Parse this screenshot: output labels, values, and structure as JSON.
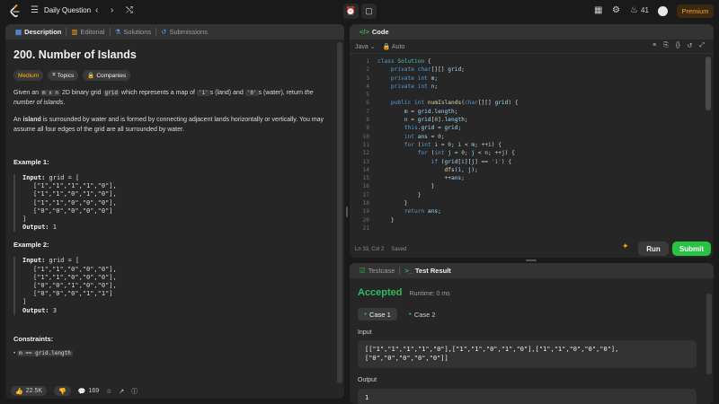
{
  "topbar": {
    "problem_list_label": "Daily Question",
    "streak_count": "41",
    "premium_label": "Premium"
  },
  "description_panel": {
    "tabs": [
      {
        "label": "Description"
      },
      {
        "label": "Editorial"
      },
      {
        "label": "Solutions"
      },
      {
        "label": "Submissions"
      }
    ],
    "title": "200. Number of Islands",
    "chips": [
      {
        "label": "Medium"
      },
      {
        "label": "Topics"
      },
      {
        "label": "Companies"
      }
    ],
    "para1": {
      "a": "Given an ",
      "code1": "m x n",
      "b": " 2D binary grid ",
      "code2": "grid",
      "c": " which represents a map of ",
      "code3": "'1'",
      "d": "s (land) and ",
      "code4": "'0'",
      "e": "s (water), return ",
      "f": "the number of islands",
      "g": "."
    },
    "para2": {
      "a": "An ",
      "b": "island",
      "c": " is surrounded by water and is formed by connecting adjacent lands horizontally or vertically. You may assume all four edges of the grid are all surrounded by water."
    },
    "example1": {
      "title": "Example 1:",
      "input_label": "Input:",
      "input_head": " grid = [",
      "rows": [
        "[\"1\",\"1\",\"1\",\"1\",\"0\"],",
        "[\"1\",\"1\",\"0\",\"1\",\"0\"],",
        "[\"1\",\"1\",\"0\",\"0\",\"0\"],",
        "[\"0\",\"0\",\"0\",\"0\",\"0\"]"
      ],
      "close": "]",
      "output_label": "Output:",
      "output_value": " 1"
    },
    "example2": {
      "title": "Example 2:",
      "input_label": "Input:",
      "input_head": " grid = [",
      "rows": [
        "[\"1\",\"1\",\"0\",\"0\",\"0\"],",
        "[\"1\",\"1\",\"0\",\"0\",\"0\"],",
        "[\"0\",\"0\",\"1\",\"0\",\"0\"],",
        "[\"0\",\"0\",\"0\",\"1\",\"1\"]"
      ],
      "close": "]",
      "output_label": "Output:",
      "output_value": " 3"
    },
    "constraints_title": "Constraints:",
    "constraint_partial": "m == grid.length",
    "footer": {
      "likes": "22.5K",
      "comments": "169"
    }
  },
  "code_panel": {
    "title": "Code",
    "language": "Java",
    "mode": "Auto",
    "status": "Ln 33, Col 2",
    "saved": "Saved",
    "run_label": "Run",
    "submit_label": "Submit",
    "line_numbers": [
      "1",
      "2",
      "3",
      "4",
      "5",
      "6",
      "7",
      "8",
      "9",
      "10",
      "11",
      "12",
      "13",
      "14",
      "15",
      "16",
      "17",
      "18",
      "19",
      "20",
      "21"
    ]
  },
  "result_panel": {
    "tabs": [
      {
        "label": "Testcase"
      },
      {
        "label": "Test Result"
      }
    ],
    "verdict": "Accepted",
    "runtime": "Runtime: 0 ms",
    "cases": [
      {
        "label": "Case 1"
      },
      {
        "label": "Case 2"
      }
    ],
    "input_label": "Input",
    "input_line1": "[[\"1\",\"1\",\"1\",\"1\",\"0\"],[\"1\",\"1\",\"0\",\"1\",\"0\"],[\"1\",\"1\",\"0\",\"0\",\"0\"],",
    "input_line2": "[\"0\",\"0\",\"0\",\"0\",\"0\"]]",
    "output_label": "Output",
    "output_value": "1"
  },
  "colors": {
    "accent": "#ffa116",
    "accepted": "#2cbb5d",
    "medium": "#ffb800",
    "submit": "#28c244"
  }
}
